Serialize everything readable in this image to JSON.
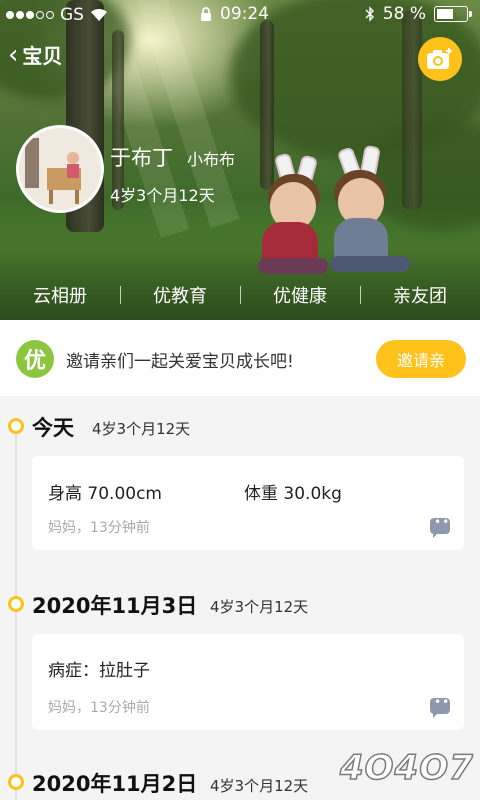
{
  "status_bar": {
    "carrier": "GS",
    "time": "09:24",
    "battery": "58 %",
    "battery_level": 0.58
  },
  "nav": {
    "title": "宝贝"
  },
  "profile": {
    "name": "于布丁",
    "nickname": "小布布",
    "age": "4岁3个月12天"
  },
  "hero_tabs": [
    {
      "label": "云相册"
    },
    {
      "label": "优教育"
    },
    {
      "label": "优健康"
    },
    {
      "label": "亲友团"
    }
  ],
  "invite": {
    "badge": "优",
    "text": "邀请亲们一起关爱宝贝成长吧!",
    "button": "邀请亲"
  },
  "timeline": [
    {
      "date": "今天",
      "age": "4岁3个月12天",
      "card": {
        "line1_a": "身高  70.00cm",
        "line1_b": "体重  30.0kg",
        "meta": "妈妈，13分钟前"
      }
    },
    {
      "date": "2020年11月3日",
      "age": "4岁3个月12天",
      "card": {
        "line1_a": "病症：拉肚子",
        "meta": "妈妈，13分钟前"
      }
    },
    {
      "date": "2020年11月2日",
      "age": "4岁3个月12天"
    }
  ],
  "watermark": "4O4O7",
  "colors": {
    "accent": "#ffc21a",
    "badge_green": "#8cc63f",
    "background": "#f4f4f4"
  }
}
